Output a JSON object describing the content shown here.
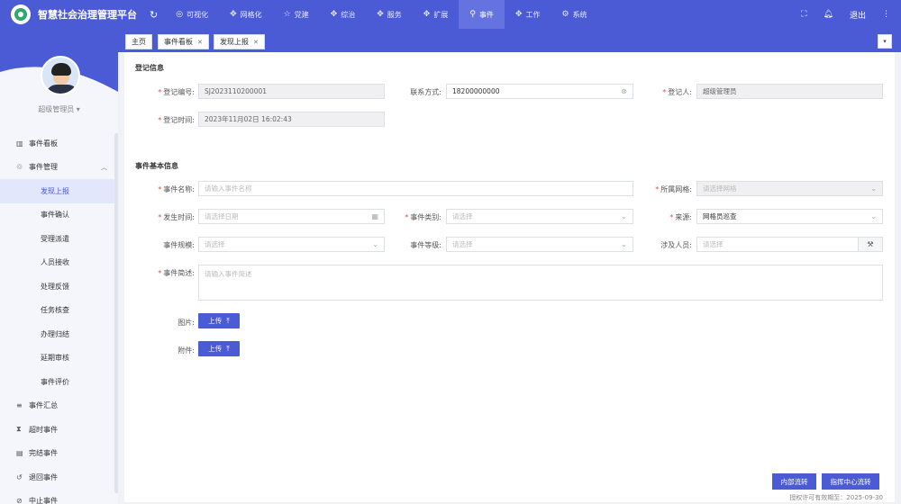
{
  "app": {
    "title": "智慧社会治理管理平台",
    "brand_color": "#4b5bd6"
  },
  "topnav": [
    {
      "icon": "eye-icon",
      "glyph": "◎",
      "label": "可视化",
      "active": false
    },
    {
      "icon": "grid-icon",
      "glyph": "✥",
      "label": "网格化",
      "active": false
    },
    {
      "icon": "star-icon",
      "glyph": "☆",
      "label": "党建",
      "active": false
    },
    {
      "icon": "composite-icon",
      "glyph": "✥",
      "label": "综治",
      "active": false
    },
    {
      "icon": "service-icon",
      "glyph": "✥",
      "label": "服务",
      "active": false
    },
    {
      "icon": "expand-icon",
      "glyph": "✥",
      "label": "扩展",
      "active": false
    },
    {
      "icon": "location-icon",
      "glyph": "⚲",
      "label": "事件",
      "active": true
    },
    {
      "icon": "work-icon",
      "glyph": "✥",
      "label": "工作",
      "active": false
    },
    {
      "icon": "system-icon",
      "glyph": "⚙",
      "label": "系统",
      "active": false
    }
  ],
  "topright": {
    "logout_label": "退出"
  },
  "user": {
    "name": "超级管理员"
  },
  "sidebar": {
    "items": [
      {
        "type": "item",
        "icon": "chart-icon",
        "glyph": "▥",
        "label": "事件看板"
      },
      {
        "type": "item",
        "icon": "shield-icon",
        "glyph": "♲",
        "label": "事件管理",
        "expanded": true
      },
      {
        "type": "sub",
        "label": "发现上报",
        "active": true
      },
      {
        "type": "sub",
        "label": "事件确认"
      },
      {
        "type": "sub",
        "label": "受理派遣"
      },
      {
        "type": "sub",
        "label": "人员接收"
      },
      {
        "type": "sub",
        "label": "处理反馈"
      },
      {
        "type": "sub",
        "label": "任务核查"
      },
      {
        "type": "sub",
        "label": "办理归结"
      },
      {
        "type": "sub",
        "label": "延期审核"
      },
      {
        "type": "sub",
        "label": "事件评价"
      },
      {
        "type": "item",
        "icon": "list-icon",
        "glyph": "≡",
        "label": "事件汇总"
      },
      {
        "type": "item",
        "icon": "hourglass-icon",
        "glyph": "⧗",
        "label": "超时事件"
      },
      {
        "type": "item",
        "icon": "document-icon",
        "glyph": "▤",
        "label": "完结事件"
      },
      {
        "type": "item",
        "icon": "return-icon",
        "glyph": "↺",
        "label": "退回事件"
      },
      {
        "type": "item",
        "icon": "stop-icon",
        "glyph": "⊘",
        "label": "中止事件"
      }
    ]
  },
  "tabs": [
    {
      "label": "主页",
      "closable": false
    },
    {
      "label": "事件看板",
      "closable": true
    },
    {
      "label": "发现上报",
      "closable": true
    }
  ],
  "form": {
    "section_register": "登记信息",
    "reg_no": {
      "label": "登记编号:",
      "value": "SJ2023110200001"
    },
    "contact": {
      "label": "联系方式:",
      "value": "18200000000"
    },
    "registrant": {
      "label": "登记人:",
      "value": "超级管理员"
    },
    "reg_time": {
      "label": "登记时间:",
      "value": "2023年11月02日 16:02:43"
    },
    "section_basic": "事件基本信息",
    "event_name": {
      "label": "事件名称:",
      "placeholder": "请输入事件名称"
    },
    "grid": {
      "label": "所属网格:",
      "placeholder": "请选择网格"
    },
    "occur_time": {
      "label": "发生时间:",
      "placeholder": "请选择日期"
    },
    "category": {
      "label": "事件类别:",
      "placeholder": "请选择"
    },
    "source": {
      "label": "来源:",
      "value": "网格员巡查"
    },
    "scale": {
      "label": "事件规模:",
      "placeholder": "请选择"
    },
    "level": {
      "label": "事件等级:",
      "placeholder": "请选择"
    },
    "persons": {
      "label": "涉及人员:",
      "placeholder": "请选择"
    },
    "desc": {
      "label": "事件简述:",
      "placeholder": "请输入事件简述"
    },
    "images": {
      "label": "图片:",
      "button": "上传"
    },
    "attachments": {
      "label": "附件:",
      "button": "上传"
    }
  },
  "actions": {
    "internal": "内部流转",
    "command_center": "指挥中心流转"
  },
  "footer": {
    "license": "授权许可有效期至：2025-09-30"
  }
}
